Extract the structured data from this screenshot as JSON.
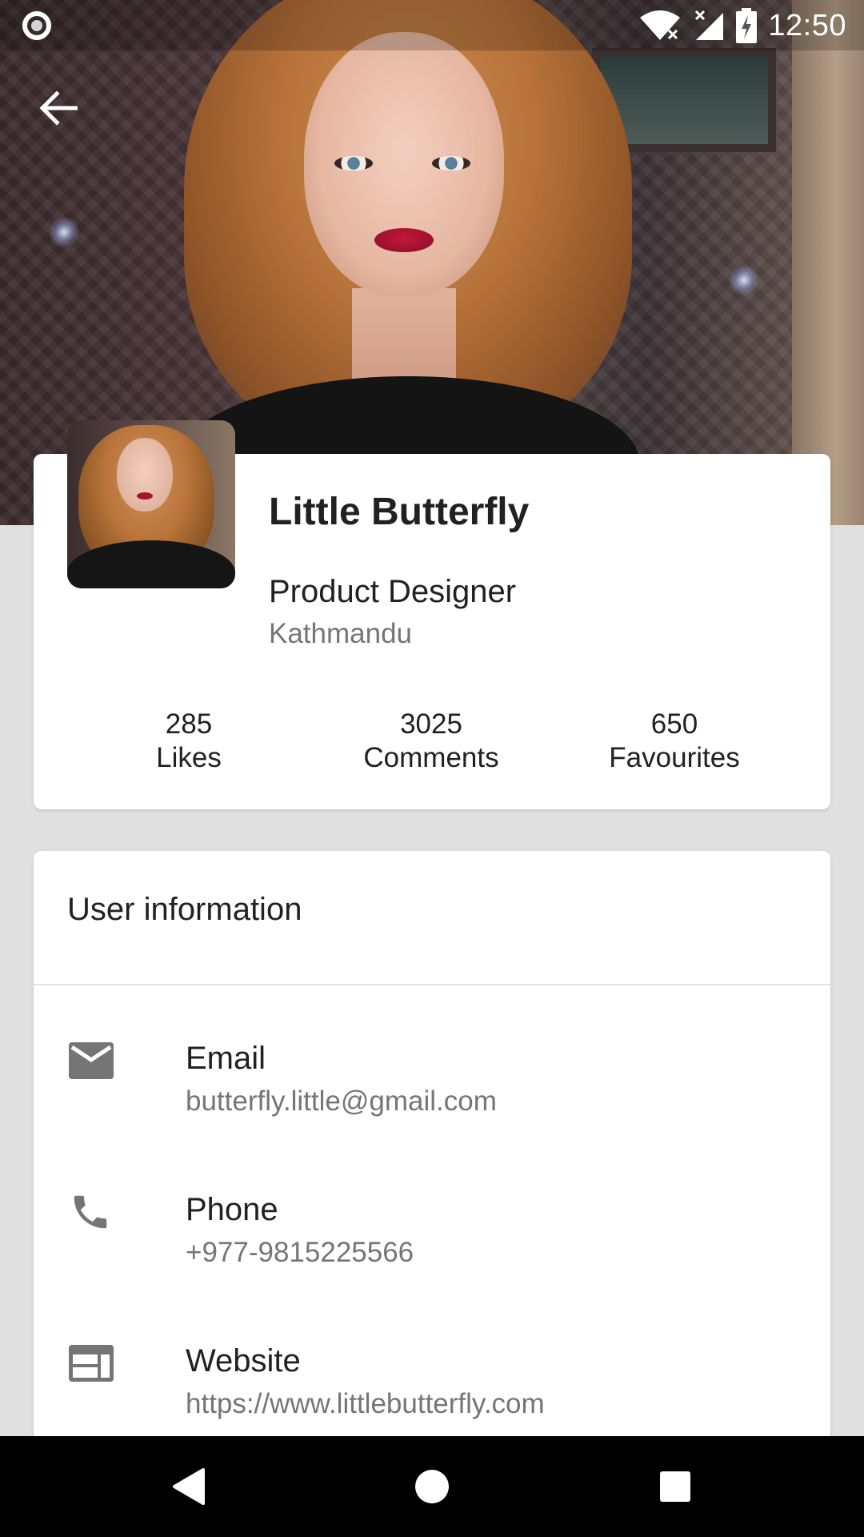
{
  "status_bar": {
    "time": "12:50",
    "icons": [
      "circle-indicator-icon",
      "wifi-icon",
      "signal-icon",
      "battery-charging-icon"
    ]
  },
  "header": {
    "back_icon": "arrow-left-icon"
  },
  "profile": {
    "name": "Little Butterfly",
    "role": "Product Designer",
    "location": "Kathmandu",
    "stats": [
      {
        "value": "285",
        "label": "Likes"
      },
      {
        "value": "3025",
        "label": "Comments"
      },
      {
        "value": "650",
        "label": "Favourites"
      }
    ]
  },
  "user_info": {
    "title": "User information",
    "items": [
      {
        "icon": "email-icon",
        "label": "Email",
        "value": "butterfly.little@gmail.com"
      },
      {
        "icon": "phone-icon",
        "label": "Phone",
        "value": "+977-9815225566"
      },
      {
        "icon": "web-icon",
        "label": "Website",
        "value": "https://www.littlebutterfly.com"
      }
    ]
  },
  "nav_bar": {
    "buttons": [
      "back-triangle-icon",
      "home-circle-icon",
      "recents-square-icon"
    ]
  },
  "colors": {
    "background": "#e0e0e0",
    "card": "#ffffff",
    "primary_text": "#212121",
    "secondary_text": "#757575",
    "icon": "#757575"
  }
}
